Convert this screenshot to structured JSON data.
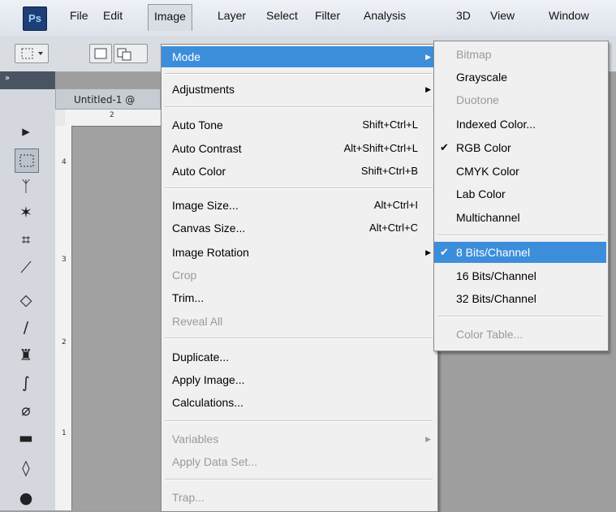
{
  "app": {
    "logo": "Ps"
  },
  "menubar": {
    "items": [
      "File",
      "Edit",
      "Image",
      "Layer",
      "Select",
      "Filter",
      "Analysis",
      "3D",
      "View",
      "Window"
    ],
    "active": "Image"
  },
  "document": {
    "tab_label": "Untitled-1 @"
  },
  "image_menu": {
    "items": [
      {
        "label": "Mode",
        "highlighted": true,
        "submenu": true
      },
      {
        "label": "Adjustments",
        "submenu": true
      },
      {
        "label": "Auto Tone",
        "shortcut": "Shift+Ctrl+L"
      },
      {
        "label": "Auto Contrast",
        "shortcut": "Alt+Shift+Ctrl+L"
      },
      {
        "label": "Auto Color",
        "shortcut": "Shift+Ctrl+B"
      },
      {
        "label": "Image Size...",
        "shortcut": "Alt+Ctrl+I"
      },
      {
        "label": "Canvas Size...",
        "shortcut": "Alt+Ctrl+C"
      },
      {
        "label": "Image Rotation",
        "submenu": true
      },
      {
        "label": "Crop",
        "disabled": true
      },
      {
        "label": "Trim..."
      },
      {
        "label": "Reveal All",
        "disabled": true
      },
      {
        "label": "Duplicate..."
      },
      {
        "label": "Apply Image..."
      },
      {
        "label": "Calculations..."
      },
      {
        "label": "Variables",
        "disabled": true,
        "submenu": true
      },
      {
        "label": "Apply Data Set...",
        "disabled": true
      },
      {
        "label": "Trap...",
        "disabled": true
      }
    ]
  },
  "mode_submenu": {
    "items": [
      {
        "label": "Bitmap",
        "disabled": true
      },
      {
        "label": "Grayscale"
      },
      {
        "label": "Duotone",
        "disabled": true
      },
      {
        "label": "Indexed Color..."
      },
      {
        "label": "RGB Color",
        "checked": true
      },
      {
        "label": "CMYK Color"
      },
      {
        "label": "Lab Color"
      },
      {
        "label": "Multichannel"
      },
      {
        "label": "8 Bits/Channel",
        "checked": true,
        "highlighted": true
      },
      {
        "label": "16 Bits/Channel"
      },
      {
        "label": "32 Bits/Channel"
      },
      {
        "label": "Color Table...",
        "disabled": true
      }
    ]
  },
  "rulers": {
    "horizontal": [
      "2"
    ],
    "vertical": [
      "4",
      "3",
      "2",
      "1"
    ]
  },
  "colors": {
    "highlight": "#3c8edb",
    "disabled_text": "#9a9a9a",
    "menu_bg": "#f0f0f0"
  },
  "icons": {
    "move": "move-tool-icon",
    "marquee": "rect-marquee-icon",
    "lasso": "lasso-icon",
    "wand": "magic-wand-icon",
    "crop": "crop-icon",
    "eyedropper": "eyedropper-icon",
    "healing": "healing-brush-icon",
    "brush": "brush-icon",
    "stamp": "clone-stamp-icon",
    "history": "history-brush-icon",
    "eraser": "eraser-icon",
    "gradient": "gradient-icon",
    "blur": "blur-icon",
    "dodge": "dodge-icon"
  }
}
